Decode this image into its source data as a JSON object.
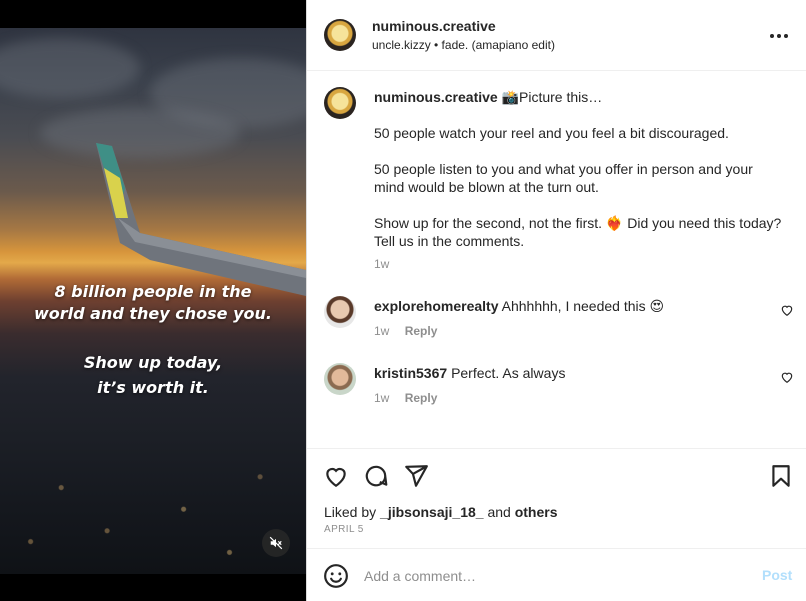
{
  "media": {
    "overlay_line1": "8 billion people in the",
    "overlay_line2": "world and they chose you.",
    "overlay_line3": "Show up today,",
    "overlay_line4": "it’s worth it.",
    "mute_icon": "speaker-muted-icon"
  },
  "header": {
    "username": "numinous.creative",
    "audio": "uncle.kizzy • fade. (amapiano edit)",
    "more_icon": "more-horizontal-icon"
  },
  "caption": {
    "username": "numinous.creative",
    "line1": "📸Picture this…",
    "para2": "50 people watch your reel and you feel a bit discouraged.",
    "para3": "50 people listen to you and what you offer in person and your mind would be blown at the turn out.",
    "para4": "Show up for the second, not the first. ❤️‍🔥 Did you need this today? Tell us in the comments.",
    "time": "1w"
  },
  "comments": [
    {
      "username": "explorehomerealty",
      "text": "Ahhhhhh, I needed this 😍",
      "time": "1w",
      "reply": "Reply"
    },
    {
      "username": "kristin5367",
      "text": "Perfect. As always",
      "time": "1w",
      "reply": "Reply"
    }
  ],
  "actions": {
    "liked_prefix": "Liked by ",
    "liked_user": "_jibsonsaji_18_",
    "liked_and": " and ",
    "liked_others": "others",
    "date": "APRIL 5"
  },
  "add_comment": {
    "placeholder": "Add a comment…",
    "post_label": "Post"
  },
  "colors": {
    "text": "#262626",
    "muted": "#8e8e8e",
    "post_disabled": "#b2dffc",
    "divider": "#efefef"
  }
}
